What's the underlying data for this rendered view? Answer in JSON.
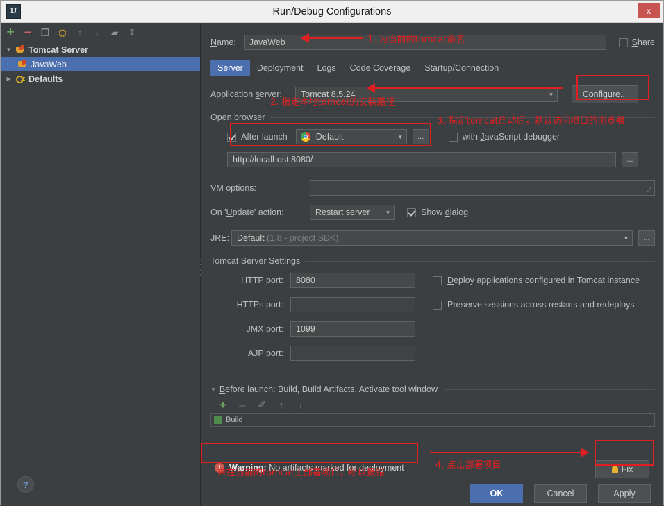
{
  "window": {
    "title": "Run/Debug Configurations",
    "app_icon": "intellij-idea-icon",
    "close_label": "x"
  },
  "left_panel": {
    "toolbar": [
      {
        "name": "add-configuration-button",
        "glyph": "+"
      },
      {
        "name": "remove-configuration-button",
        "glyph": "–"
      },
      {
        "name": "copy-configuration-button",
        "glyph": "❐"
      },
      {
        "name": "edit-templates-button",
        "glyph": "⛭"
      },
      {
        "name": "move-up-button",
        "glyph": "↑"
      },
      {
        "name": "move-down-button",
        "glyph": "↓"
      },
      {
        "name": "create-folder-button",
        "glyph": "▰"
      },
      {
        "name": "sort-configurations-button",
        "glyph": "↧"
      }
    ],
    "tree": [
      {
        "label": "Tomcat Server",
        "twisty": "▼",
        "icon": "tomcat-icon",
        "selected": false,
        "bold": true,
        "indent": 0
      },
      {
        "label": "JavaWeb",
        "twisty": "",
        "icon": "tomcat-icon",
        "selected": true,
        "bold": false,
        "indent": 1
      },
      {
        "label": "Defaults",
        "twisty": "▶",
        "icon": "defaults-icon",
        "selected": false,
        "bold": true,
        "indent": 0
      }
    ],
    "help_label": "?"
  },
  "form": {
    "name_label": "Name:",
    "name_value": "JavaWeb",
    "share_label": "Share",
    "share_checked": false,
    "tabs": [
      {
        "label": "Server",
        "active": true
      },
      {
        "label": "Deployment",
        "active": false
      },
      {
        "label": "Logs",
        "active": false
      },
      {
        "label": "Code Coverage",
        "active": false
      },
      {
        "label": "Startup/Connection",
        "active": false
      }
    ],
    "application_server_label": "Application server:",
    "application_server_value": "Tomcat 8.5.24",
    "configure_label": "Configure...",
    "open_browser_group": "Open browser",
    "after_launch_label": "After launch",
    "after_launch_checked": true,
    "browser_value": "Default",
    "browser_icon": "chrome-icon",
    "browse_ellipsis": "...",
    "js_debugger_label": "with JavaScript debugger",
    "js_debugger_checked": false,
    "url_value": "http://localhost:8080/",
    "vm_options_label": "VM options:",
    "vm_options_value": "",
    "update_action_label": "On 'Update' action:",
    "update_action_value": "Restart server",
    "show_dialog_label": "Show dialog",
    "show_dialog_checked": true,
    "jre_label": "JRE:",
    "jre_value": "Default",
    "jre_hint": "(1.8 - project SDK)",
    "tomcat_settings_group": "Tomcat Server Settings",
    "ports": [
      {
        "label": "HTTP port:",
        "value": "8080"
      },
      {
        "label": "HTTPs port:",
        "value": ""
      },
      {
        "label": "JMX port:",
        "value": "1099"
      },
      {
        "label": "AJP port:",
        "value": ""
      }
    ],
    "deploy_apps_label": "Deploy applications configured in Tomcat instance",
    "deploy_apps_checked": false,
    "preserve_sessions_label": "Preserve sessions across restarts and redeploys",
    "preserve_sessions_checked": false,
    "before_launch_label": "Before launch: Build, Build Artifacts, Activate tool window",
    "before_launch_toolbar": [
      {
        "name": "before-launch-add-button",
        "glyph": "+"
      },
      {
        "name": "before-launch-remove-button",
        "glyph": "–"
      },
      {
        "name": "before-launch-edit-button",
        "glyph": "✐"
      },
      {
        "name": "before-launch-up-button",
        "glyph": "↑"
      },
      {
        "name": "before-launch-down-button",
        "glyph": "↓"
      }
    ],
    "before_launch_item": "Build"
  },
  "warning": {
    "icon": "warning-icon",
    "prefix": "Warning:",
    "message": "No artifacts marked for deployment",
    "fix_label": "Fix",
    "fix_icon": "lightbulb-icon"
  },
  "dialog_buttons": [
    {
      "label": "OK",
      "primary": true,
      "name": "ok-button"
    },
    {
      "label": "Cancel",
      "primary": false,
      "name": "cancel-button"
    },
    {
      "label": "Apply",
      "primary": false,
      "name": "apply-button"
    }
  ],
  "annotations": {
    "accent_color": "#e02020",
    "note1": "1. 为当前的tomcat命名",
    "note2": "2. 指定本地tomcat的安装路径",
    "note3": "3. 指定tomcat启动后，默认访问项目的浏览器",
    "note4": "4. 点击部署项目",
    "note5": "未在当前的tomcat上部署项目，所以报错"
  }
}
